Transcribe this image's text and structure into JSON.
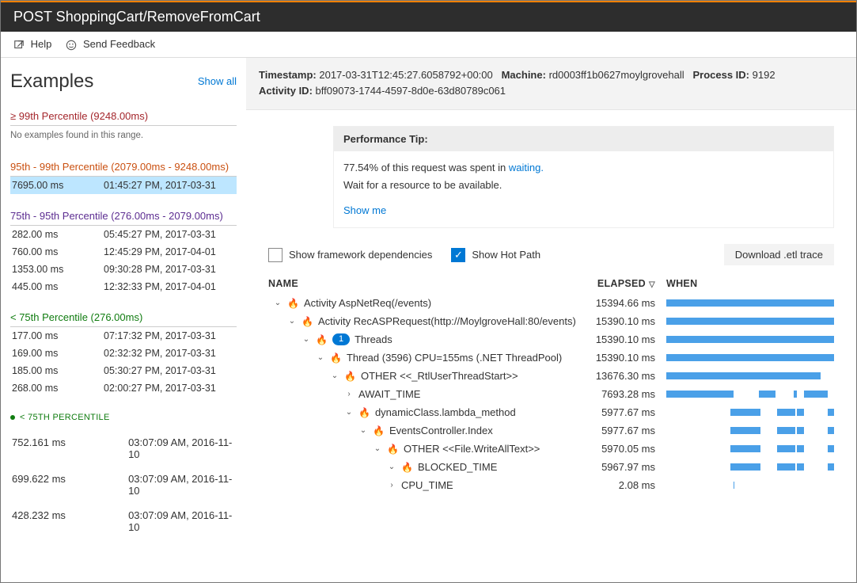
{
  "titlebar": "POST ShoppingCart/RemoveFromCart",
  "toolbar": {
    "help": "Help",
    "feedback": "Send Feedback"
  },
  "sidebar": {
    "heading": "Examples",
    "showall": "Show all",
    "groups": [
      {
        "label": "≥ 99th Percentile (9248.00ms)",
        "cls": "perc-red",
        "no_examples": "No examples found in this range.",
        "rows": []
      },
      {
        "label": "95th - 99th Percentile (2079.00ms - 9248.00ms)",
        "cls": "perc-orange",
        "rows": [
          {
            "ms": "7695.00 ms",
            "ts": "01:45:27 PM, 2017-03-31",
            "selected": true
          }
        ]
      },
      {
        "label": "75th - 95th Percentile (276.00ms - 2079.00ms)",
        "cls": "perc-purple",
        "rows": [
          {
            "ms": "282.00 ms",
            "ts": "05:45:27 PM, 2017-03-31"
          },
          {
            "ms": "760.00 ms",
            "ts": "12:45:29 PM, 2017-04-01"
          },
          {
            "ms": "1353.00 ms",
            "ts": "09:30:28 PM, 2017-03-31"
          },
          {
            "ms": "445.00 ms",
            "ts": "12:32:33 PM, 2017-04-01"
          }
        ]
      },
      {
        "label": "< 75th Percentile (276.00ms)",
        "cls": "perc-green",
        "rows": [
          {
            "ms": "177.00 ms",
            "ts": "07:17:32 PM, 2017-03-31"
          },
          {
            "ms": "169.00 ms",
            "ts": "02:32:32 PM, 2017-03-31"
          },
          {
            "ms": "185.00 ms",
            "ts": "05:30:27 PM, 2017-03-31"
          },
          {
            "ms": "268.00 ms",
            "ts": "02:00:27 PM, 2017-03-31"
          }
        ]
      }
    ],
    "bullet_label": "< 75TH PERCENTILE",
    "bottom": [
      {
        "ms": "752.161 ms",
        "ts": "03:07:09 AM, 2016-11-10"
      },
      {
        "ms": "699.622 ms",
        "ts": "03:07:09 AM, 2016-11-10"
      },
      {
        "ms": "428.232 ms",
        "ts": "03:07:09 AM, 2016-11-10"
      }
    ]
  },
  "meta": {
    "timestamp_label": "Timestamp:",
    "timestamp": "2017-03-31T12:45:27.6058792+00:00",
    "machine_label": "Machine:",
    "machine": "rd0003ff1b0627moylgrovehall",
    "processid_label": "Process ID:",
    "processid": "9192",
    "activityid_label": "Activity ID:",
    "activityid": "bff09073-1744-4597-8d0e-63d80789c061"
  },
  "tip": {
    "title": "Performance Tip:",
    "line1_pre": "77.54% of this request was spent in ",
    "line1_link": "waiting.",
    "line2": "Wait for a resource to be available.",
    "showme": "Show me"
  },
  "controls": {
    "framework": "Show framework dependencies",
    "hotpath": "Show Hot Path",
    "download": "Download .etl trace"
  },
  "table": {
    "headers": {
      "name": "NAME",
      "elapsed": "ELAPSED",
      "when": "WHEN"
    },
    "rows": [
      {
        "indent": 0,
        "chev": "v",
        "flame": true,
        "name": "Activity AspNetReq(/events)",
        "elapsed": "15394.66 ms",
        "bars": [
          [
            0,
            100
          ]
        ]
      },
      {
        "indent": 1,
        "chev": "v",
        "flame": true,
        "name": "Activity RecASPRequest(http://MoylgroveHall:80/events)",
        "elapsed": "15390.10 ms",
        "bars": [
          [
            0,
            100
          ]
        ]
      },
      {
        "indent": 2,
        "chev": "v",
        "flame": true,
        "badge": "1",
        "name": "Threads",
        "elapsed": "15390.10 ms",
        "bars": [
          [
            0,
            100
          ]
        ]
      },
      {
        "indent": 3,
        "chev": "v",
        "flame": true,
        "name": "Thread (3596) CPU=155ms (.NET ThreadPool)",
        "elapsed": "15390.10 ms",
        "bars": [
          [
            0,
            100
          ]
        ]
      },
      {
        "indent": 4,
        "chev": "v",
        "flame": true,
        "name": "OTHER <<_RtlUserThreadStart>>",
        "elapsed": "13676.30 ms",
        "bars": [
          [
            0,
            92
          ]
        ]
      },
      {
        "indent": 5,
        "chev": ">",
        "flame": false,
        "name": "AWAIT_TIME",
        "elapsed": "7693.28 ms",
        "bars": [
          [
            0,
            40
          ],
          [
            55,
            10
          ],
          [
            76,
            2
          ],
          [
            82,
            14
          ]
        ]
      },
      {
        "indent": 5,
        "chev": "v",
        "flame": true,
        "name": "dynamicClass.lambda_method",
        "elapsed": "5977.67 ms",
        "bars": [
          [
            38,
            18
          ],
          [
            66,
            11
          ],
          [
            78,
            4
          ],
          [
            96,
            4
          ]
        ]
      },
      {
        "indent": 6,
        "chev": "v",
        "flame": true,
        "name": "EventsController.Index",
        "elapsed": "5977.67 ms",
        "bars": [
          [
            38,
            18
          ],
          [
            66,
            11
          ],
          [
            78,
            4
          ],
          [
            96,
            4
          ]
        ]
      },
      {
        "indent": 7,
        "chev": "v",
        "flame": true,
        "name": "OTHER <<File.WriteAllText>>",
        "elapsed": "5970.05 ms",
        "bars": [
          [
            38,
            18
          ],
          [
            66,
            11
          ],
          [
            78,
            4
          ],
          [
            96,
            4
          ]
        ]
      },
      {
        "indent": 8,
        "chev": "v",
        "flame": true,
        "name": "BLOCKED_TIME",
        "elapsed": "5967.97 ms",
        "bars": [
          [
            38,
            18
          ],
          [
            66,
            11
          ],
          [
            78,
            4
          ],
          [
            96,
            4
          ]
        ]
      },
      {
        "indent": 8,
        "chev": ">",
        "flame": false,
        "name": "CPU_TIME",
        "elapsed": "2.08 ms",
        "bars": [
          [
            40,
            0.7
          ]
        ]
      }
    ]
  }
}
